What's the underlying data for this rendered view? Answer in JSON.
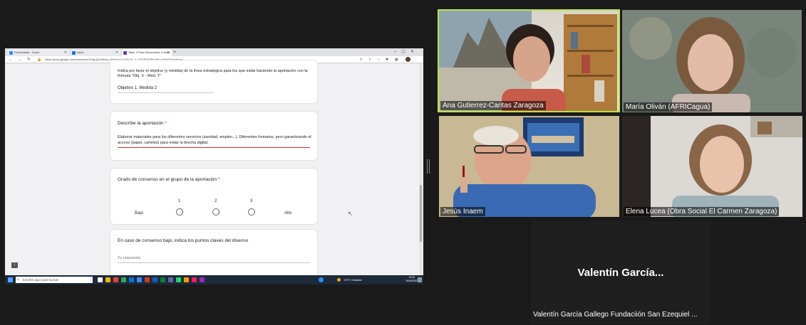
{
  "browser": {
    "tabs": [
      {
        "label": "Presentaste - Zoom",
        "color": "#2d8cff"
      },
      {
        "label": "Inicio",
        "color": "#1a73e8"
      },
      {
        "label": "Taller 3 Plan ADiversidad Cultura",
        "color": "#673ab7"
      }
    ],
    "url": "https://docs.google.com/forms/d/e/1FAIpQLSdfr9q_RSrNqqJYx43gCK_e_6ZOR4fO8fsA8Ixd-W8sl7/viewform"
  },
  "form": {
    "card1": {
      "text": "Indica por favor el objetivo (y medida) de la línea estratégica para los que estás haciendo la aportación con la fórmula \"Obj. X - Med. Y\"",
      "answer": "Objetivo 1. Medida 2"
    },
    "card2": {
      "question": "Describe la aportación",
      "required": "*",
      "answer": "Elaborar materiales para los diferentes servicios (sanidad, empleo...). Diferentes formatos, pero garantizando el acceso (papel, carteles) para evitar la brecha digital."
    },
    "card3": {
      "question": "Grado de consenso en el grupo de la aportación",
      "required": "*",
      "scale": [
        "1",
        "2",
        "3"
      ],
      "low": "Bajo",
      "high": "Alto"
    },
    "card4": {
      "question": "En caso de consenso bajo, indica los puntos claves del disenso",
      "placeholder": "Tu respuesta"
    }
  },
  "taskbar": {
    "search_placeholder": "Escribe aquí para buscar",
    "weather": "20°C Soleado",
    "time": "13:53",
    "date": "16/06/2022"
  },
  "participants": {
    "ana": "Ana Gutierrez-Caritas Zaragoza",
    "maria": "María Oliván (AFRICagua)",
    "jesus": "Jesús Inaem",
    "elena": "Elena Lucea (Obra Social El Carmen Zaragoza)",
    "valentin_short": "Valentín García...",
    "valentin_full": "Valentín García Gallego Fundaciión San Ezequiel ..."
  },
  "colors": {
    "active_speaker": "#b8e34a",
    "required": "#d93025"
  }
}
